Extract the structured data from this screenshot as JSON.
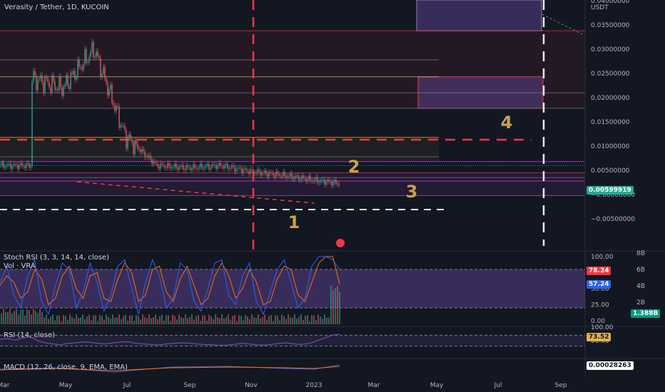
{
  "header": {
    "symbol": "Verasity / Tether, 1D, KUCOIN"
  },
  "indicators": {
    "stoch_rsi": "Stoch RSI (3, 3, 14, 14, close)",
    "vol": "Vol · VRA",
    "rsi": "RSI (14, close)",
    "macd": "MACD (12, 26, close, 9, EMA, EMA)"
  },
  "annotations": [
    "1",
    "2",
    "3",
    "4"
  ],
  "colors": {
    "background": "#131722",
    "up": "#26a69a",
    "down": "#ef5350",
    "stoch_k": "#2962ff",
    "stoch_d": "#ff6d00",
    "rsi": "#7e57c2",
    "annotation": "#c9a24a",
    "dash_red": "#f23645"
  },
  "chart_data": {
    "type": "candlestick",
    "price_axis": {
      "unit": "USDT",
      "ticks": [
        0.04,
        0.035,
        0.03,
        0.025,
        0.02,
        0.015,
        0.01,
        0.005,
        0,
        -0.005
      ],
      "tick_labels": [
        "0.04000000",
        "0.03500000",
        "0.03000000",
        "0.02500000",
        "0.02000000",
        "0.01500000",
        "0.01000000",
        "0.00500000",
        "−0.00000000",
        "−0.00500000"
      ],
      "last_price": 0.00599919,
      "last_price_label": "0.00599919"
    },
    "time_axis": {
      "labels": [
        "Mar",
        "May",
        "Jul",
        "Sep",
        "Nov",
        "2023",
        "Mar",
        "May",
        "Jul",
        "Sep"
      ]
    },
    "close_series": [
      {
        "x": "Feb 2022",
        "y": 0.024
      },
      {
        "x": "Mar 2022",
        "y": 0.022
      },
      {
        "x": "Apr 2022",
        "y": 0.03
      },
      {
        "x": "May 2022",
        "y": 0.012
      },
      {
        "x": "Jun 2022",
        "y": 0.006
      },
      {
        "x": "Jul 2022",
        "y": 0.0055
      },
      {
        "x": "Aug 2022",
        "y": 0.006
      },
      {
        "x": "Sep 2022",
        "y": 0.0048
      },
      {
        "x": "Oct 2022",
        "y": 0.004
      },
      {
        "x": "Nov 2022",
        "y": 0.003
      },
      {
        "x": "Dec 2022",
        "y": 0.0022
      },
      {
        "x": "Jan 2023",
        "y": 0.0024
      },
      {
        "x": "Feb 2023",
        "y": 0.006
      }
    ],
    "levels": [
      0.0338,
      0.0278,
      0.0243,
      0.021,
      0.0178,
      0.0118,
      0.0078,
      0.0068,
      0.0045,
      0.0035,
      0.0028,
      -0.0002
    ],
    "stoch_rsi": {
      "axis_labels": [
        "100.00",
        "75.00",
        "50.00",
        "25.00",
        "0.00"
      ],
      "k_value_label": "78.24",
      "d_value_label": "57.24",
      "k": [
        60,
        85,
        40,
        20,
        70,
        95,
        30,
        10,
        55,
        90,
        80,
        20,
        45,
        90,
        60,
        15,
        40,
        85,
        95,
        50,
        10,
        60,
        95,
        70,
        20,
        35,
        90,
        80,
        30,
        15,
        50,
        90,
        95,
        40,
        25,
        70,
        90,
        30,
        10,
        45,
        80,
        95,
        60,
        20,
        35,
        85,
        100,
        100,
        95,
        80
      ],
      "d": [
        55,
        70,
        60,
        35,
        45,
        80,
        65,
        25,
        35,
        70,
        85,
        50,
        35,
        70,
        75,
        35,
        30,
        65,
        90,
        75,
        30,
        40,
        80,
        85,
        45,
        30,
        65,
        85,
        55,
        25,
        35,
        70,
        90,
        70,
        35,
        50,
        80,
        60,
        25,
        30,
        65,
        85,
        80,
        40,
        30,
        60,
        90,
        100,
        100,
        57
      ]
    },
    "volume": {
      "axis_labels": [
        "8B",
        "6B",
        "4B",
        "2B"
      ],
      "last_label": "1.388B"
    },
    "rsi": {
      "axis_labels": [
        "100.00",
        "50.00"
      ],
      "value_label": "73.52",
      "values": [
        55,
        58,
        52,
        60,
        65,
        50,
        42,
        38,
        35,
        40,
        42,
        45,
        44,
        40,
        38,
        42,
        45,
        46,
        40,
        38,
        36,
        34,
        38,
        40,
        42,
        41,
        38,
        36,
        35,
        33,
        34,
        36,
        40,
        38,
        35,
        34,
        36,
        40,
        42,
        38,
        36,
        40,
        50,
        60,
        70,
        74
      ]
    },
    "macd": {
      "value_label": "0.00028263"
    }
  }
}
